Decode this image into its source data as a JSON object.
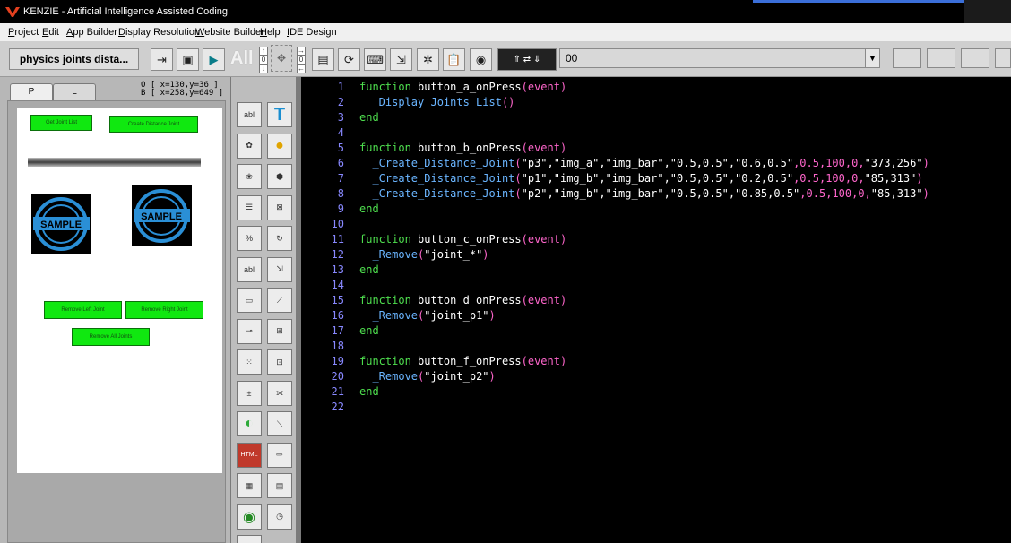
{
  "window": {
    "title": "KENZIE - Artificial Intelligence Assisted Coding"
  },
  "menu": {
    "items": [
      "Project",
      "Edit",
      "App Builder",
      "Display Resolution",
      "Website Builder",
      "Help",
      "IDE Design"
    ]
  },
  "toolbar": {
    "document_button": "physics joints dista...",
    "all_label": "All",
    "combo_value": "00"
  },
  "left_panel": {
    "tab_p": "P",
    "tab_l": "L",
    "coords_o": "O [ x=130,y=36 ]",
    "coords_b": "B [ x=258,y=649 ]"
  },
  "canvas": {
    "buttons": {
      "get_joint_list": "Get Joint List",
      "create_distance_joint": "Create Distance Joint",
      "remove_left_joint": "Remove Left Joint",
      "remove_right_joint": "Remove Right Joint",
      "remove_all_joints": "Remove All Joints"
    },
    "sample_text": "SAMPLE"
  },
  "palette": {
    "left_icons": [
      "textfield-icon",
      "image-icon",
      "image-effect-icon",
      "list-icon",
      "progress-icon",
      "textarea-icon",
      "button-icon",
      "slider-icon",
      "spinner-icon",
      "stepper-icon",
      "toggle-icon",
      "html-icon",
      "chart-icon",
      "radio-icon",
      "blank-icon"
    ],
    "right_icons": [
      "text-icon",
      "sphere-icon",
      "shape-icon",
      "joint-icon",
      "rotate-icon",
      "connect-icon",
      "link-icon",
      "graph-icon",
      "collision-icon",
      "node-icon",
      "line-icon",
      "export-icon",
      "document-icon",
      "timer-icon"
    ]
  },
  "editor": {
    "lines": [
      {
        "n": "1",
        "tokens": [
          [
            "kw",
            "function "
          ],
          [
            "fn",
            "button_a_onPress"
          ],
          [
            "pa",
            "(event)"
          ]
        ]
      },
      {
        "n": "2",
        "tokens": [
          [
            "cl",
            "  _Display_Joints_List"
          ],
          [
            "pa",
            "()"
          ]
        ]
      },
      {
        "n": "3",
        "tokens": [
          [
            "kw",
            "end"
          ]
        ]
      },
      {
        "n": "4",
        "tokens": []
      },
      {
        "n": "5",
        "tokens": [
          [
            "kw",
            "function "
          ],
          [
            "fn",
            "button_b_onPress"
          ],
          [
            "pa",
            "(event)"
          ]
        ]
      },
      {
        "n": "6",
        "tokens": [
          [
            "cl",
            "  _Create_Distance_Joint"
          ],
          [
            "pa",
            "("
          ],
          [
            "st",
            "\"p3\",\"img_a\",\"img_bar\",\"0.5,0.5\",\"0.6,0.5\""
          ],
          [
            "pa",
            ","
          ],
          [
            "nu",
            "0.5,100,0"
          ],
          [
            "pa",
            ","
          ],
          [
            "st",
            "\"373,256\""
          ],
          [
            "pa",
            ")"
          ]
        ]
      },
      {
        "n": "7",
        "tokens": [
          [
            "cl",
            "  _Create_Distance_Joint"
          ],
          [
            "pa",
            "("
          ],
          [
            "st",
            "\"p1\",\"img_b\",\"img_bar\",\"0.5,0.5\",\"0.2,0.5\""
          ],
          [
            "pa",
            ","
          ],
          [
            "nu",
            "0.5,100,0"
          ],
          [
            "pa",
            ","
          ],
          [
            "st",
            "\"85,313\""
          ],
          [
            "pa",
            ")"
          ]
        ]
      },
      {
        "n": "8",
        "tokens": [
          [
            "cl",
            "  _Create_Distance_Joint"
          ],
          [
            "pa",
            "("
          ],
          [
            "st",
            "\"p2\",\"img_b\",\"img_bar\",\"0.5,0.5\",\"0.85,0.5\""
          ],
          [
            "pa",
            ","
          ],
          [
            "nu",
            "0.5,100,0"
          ],
          [
            "pa",
            ","
          ],
          [
            "st",
            "\"85,313\""
          ],
          [
            "pa",
            ")"
          ]
        ]
      },
      {
        "n": "9",
        "tokens": [
          [
            "kw",
            "end"
          ]
        ]
      },
      {
        "n": "10",
        "tokens": []
      },
      {
        "n": "11",
        "tokens": [
          [
            "kw",
            "function "
          ],
          [
            "fn",
            "button_c_onPress"
          ],
          [
            "pa",
            "(event)"
          ]
        ]
      },
      {
        "n": "12",
        "tokens": [
          [
            "cl",
            "  _Remove"
          ],
          [
            "pa",
            "("
          ],
          [
            "st",
            "\"joint_*\""
          ],
          [
            "pa",
            ")"
          ]
        ]
      },
      {
        "n": "13",
        "tokens": [
          [
            "kw",
            "end"
          ]
        ]
      },
      {
        "n": "14",
        "tokens": []
      },
      {
        "n": "15",
        "tokens": [
          [
            "kw",
            "function "
          ],
          [
            "fn",
            "button_d_onPress"
          ],
          [
            "pa",
            "(event)"
          ]
        ]
      },
      {
        "n": "16",
        "tokens": [
          [
            "cl",
            "  _Remove"
          ],
          [
            "pa",
            "("
          ],
          [
            "st",
            "\"joint_p1\""
          ],
          [
            "pa",
            ")"
          ]
        ]
      },
      {
        "n": "17",
        "tokens": [
          [
            "kw",
            "end"
          ]
        ]
      },
      {
        "n": "18",
        "tokens": []
      },
      {
        "n": "19",
        "tokens": [
          [
            "kw",
            "function "
          ],
          [
            "fn",
            "button_f_onPress"
          ],
          [
            "pa",
            "(event)"
          ]
        ]
      },
      {
        "n": "20",
        "tokens": [
          [
            "cl",
            "  _Remove"
          ],
          [
            "pa",
            "("
          ],
          [
            "st",
            "\"joint_p2\""
          ],
          [
            "pa",
            ")"
          ]
        ]
      },
      {
        "n": "21",
        "tokens": [
          [
            "kw",
            "end"
          ]
        ]
      },
      {
        "n": "22",
        "tokens": []
      }
    ]
  }
}
